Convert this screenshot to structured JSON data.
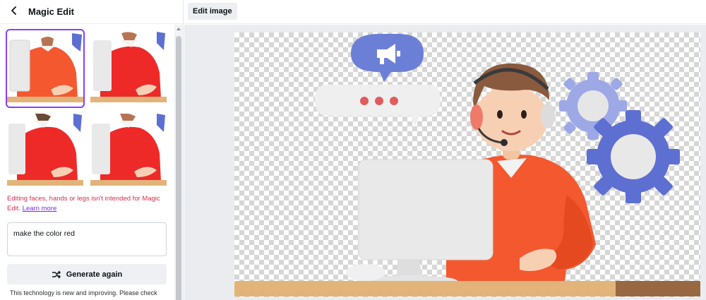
{
  "panel": {
    "title": "Magic Edit",
    "back_icon": "chevron-left-icon",
    "results": [
      {
        "label": "result-1",
        "selected": true,
        "shirt_color": "#f4582f"
      },
      {
        "label": "result-2",
        "selected": false,
        "shirt_color": "#ee2a28"
      },
      {
        "label": "result-3",
        "selected": false,
        "shirt_color": "#ee2a28"
      },
      {
        "label": "result-4",
        "selected": false,
        "shirt_color": "#ee2a28"
      }
    ],
    "warning_text": "Editing faces, hands or legs isn't intended for Magic Edit.",
    "learn_more": "Learn more",
    "prompt_value": "make the color red",
    "generate_label": "Generate again",
    "generate_icon": "shuffle-icon",
    "disclaimer": "This technology is new and improving. Please check"
  },
  "toolbar": {
    "edit_image_label": "Edit image"
  },
  "colors": {
    "accent": "#8b3dff",
    "warning": "#d6314f",
    "link": "#7d2ae8",
    "canvas_shirt": "#f4582f",
    "gear": "#5e6fd2",
    "gear_light": "#9da8e6",
    "bubble": "#6c7fd6",
    "desk": "#e2b47a"
  }
}
